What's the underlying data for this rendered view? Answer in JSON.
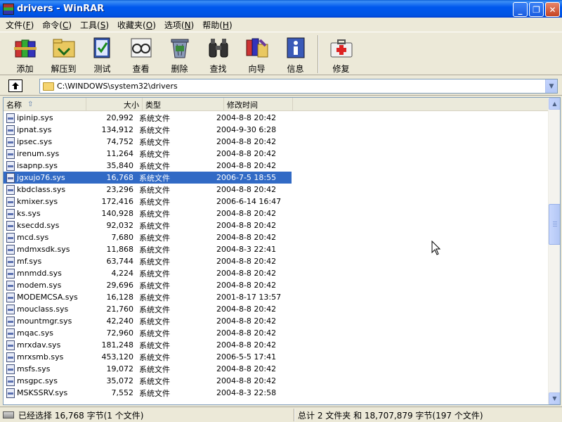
{
  "window": {
    "title": "drivers - WinRAR",
    "controls": {
      "minimize": "_",
      "maximize": "❐",
      "close": "✕"
    }
  },
  "menu": [
    {
      "label": "文件(",
      "key": "F",
      "end": ")"
    },
    {
      "label": "命令(",
      "key": "C",
      "end": ")"
    },
    {
      "label": "工具(",
      "key": "S",
      "end": ")"
    },
    {
      "label": "收藏夹(",
      "key": "O",
      "end": ")"
    },
    {
      "label": "选项(",
      "key": "N",
      "end": ")"
    },
    {
      "label": "帮助(",
      "key": "H",
      "end": ")"
    }
  ],
  "toolbar": {
    "add": "添加",
    "extract_to": "解压到",
    "test": "测试",
    "view": "查看",
    "delete": "删除",
    "find": "查找",
    "wizard": "向导",
    "info": "信息",
    "repair": "修复"
  },
  "address": {
    "path": "C:\\WINDOWS\\system32\\drivers"
  },
  "columns": {
    "name": "名称",
    "size": "大小",
    "type": "类型",
    "modified": "修改时间"
  },
  "files": [
    {
      "name": "ipinip.sys",
      "size": "20,992",
      "type": "系统文件",
      "modified": "2004-8-8 20:42"
    },
    {
      "name": "ipnat.sys",
      "size": "134,912",
      "type": "系统文件",
      "modified": "2004-9-30 6:28"
    },
    {
      "name": "ipsec.sys",
      "size": "74,752",
      "type": "系统文件",
      "modified": "2004-8-8 20:42"
    },
    {
      "name": "irenum.sys",
      "size": "11,264",
      "type": "系统文件",
      "modified": "2004-8-8 20:42"
    },
    {
      "name": "isapnp.sys",
      "size": "35,840",
      "type": "系统文件",
      "modified": "2004-8-8 20:42"
    },
    {
      "name": "jgxujo76.sys",
      "size": "16,768",
      "type": "系统文件",
      "modified": "2006-7-5 18:55",
      "selected": true
    },
    {
      "name": "kbdclass.sys",
      "size": "23,296",
      "type": "系统文件",
      "modified": "2004-8-8 20:42"
    },
    {
      "name": "kmixer.sys",
      "size": "172,416",
      "type": "系统文件",
      "modified": "2006-6-14 16:47"
    },
    {
      "name": "ks.sys",
      "size": "140,928",
      "type": "系统文件",
      "modified": "2004-8-8 20:42"
    },
    {
      "name": "ksecdd.sys",
      "size": "92,032",
      "type": "系统文件",
      "modified": "2004-8-8 20:42"
    },
    {
      "name": "mcd.sys",
      "size": "7,680",
      "type": "系统文件",
      "modified": "2004-8-8 20:42"
    },
    {
      "name": "mdmxsdk.sys",
      "size": "11,868",
      "type": "系统文件",
      "modified": "2004-8-3 22:41"
    },
    {
      "name": "mf.sys",
      "size": "63,744",
      "type": "系统文件",
      "modified": "2004-8-8 20:42"
    },
    {
      "name": "mnmdd.sys",
      "size": "4,224",
      "type": "系统文件",
      "modified": "2004-8-8 20:42"
    },
    {
      "name": "modem.sys",
      "size": "29,696",
      "type": "系统文件",
      "modified": "2004-8-8 20:42"
    },
    {
      "name": "MODEMCSA.sys",
      "size": "16,128",
      "type": "系统文件",
      "modified": "2001-8-17 13:57"
    },
    {
      "name": "mouclass.sys",
      "size": "21,760",
      "type": "系统文件",
      "modified": "2004-8-8 20:42"
    },
    {
      "name": "mountmgr.sys",
      "size": "42,240",
      "type": "系统文件",
      "modified": "2004-8-8 20:42"
    },
    {
      "name": "mqac.sys",
      "size": "72,960",
      "type": "系统文件",
      "modified": "2004-8-8 20:42"
    },
    {
      "name": "mrxdav.sys",
      "size": "181,248",
      "type": "系统文件",
      "modified": "2004-8-8 20:42"
    },
    {
      "name": "mrxsmb.sys",
      "size": "453,120",
      "type": "系统文件",
      "modified": "2006-5-5 17:41"
    },
    {
      "name": "msfs.sys",
      "size": "19,072",
      "type": "系统文件",
      "modified": "2004-8-8 20:42"
    },
    {
      "name": "msgpc.sys",
      "size": "35,072",
      "type": "系统文件",
      "modified": "2004-8-8 20:42"
    },
    {
      "name": "MSKSSRV.sys",
      "size": "7,552",
      "type": "系统文件",
      "modified": "2004-8-3 22:58"
    }
  ],
  "status": {
    "selected": "已经选择 16,768 字节(1 个文件)",
    "total": "总计 2 文件夹 和 18,707,879 字节(197 个文件)"
  },
  "scroll_position": 0.39,
  "colors": {
    "title_bar": "#0054e3",
    "selection": "#316ac5",
    "window_bg": "#ece9d8"
  }
}
